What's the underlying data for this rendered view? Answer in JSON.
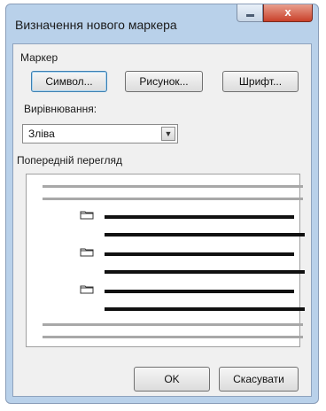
{
  "dialog": {
    "title": "Визначення нового маркера",
    "close_glyph": "x"
  },
  "marker_group": {
    "label": "Маркер",
    "buttons": {
      "symbol": "Символ...",
      "picture": "Рисунок...",
      "font": "Шрифт..."
    }
  },
  "alignment": {
    "label": "Вирівнювання:",
    "value": "Зліва",
    "arrow_icon": "▼"
  },
  "preview": {
    "label": "Попередній перегляд",
    "bullet_icon": "folder-icon"
  },
  "footer": {
    "ok": "OK",
    "cancel": "Скасувати"
  }
}
